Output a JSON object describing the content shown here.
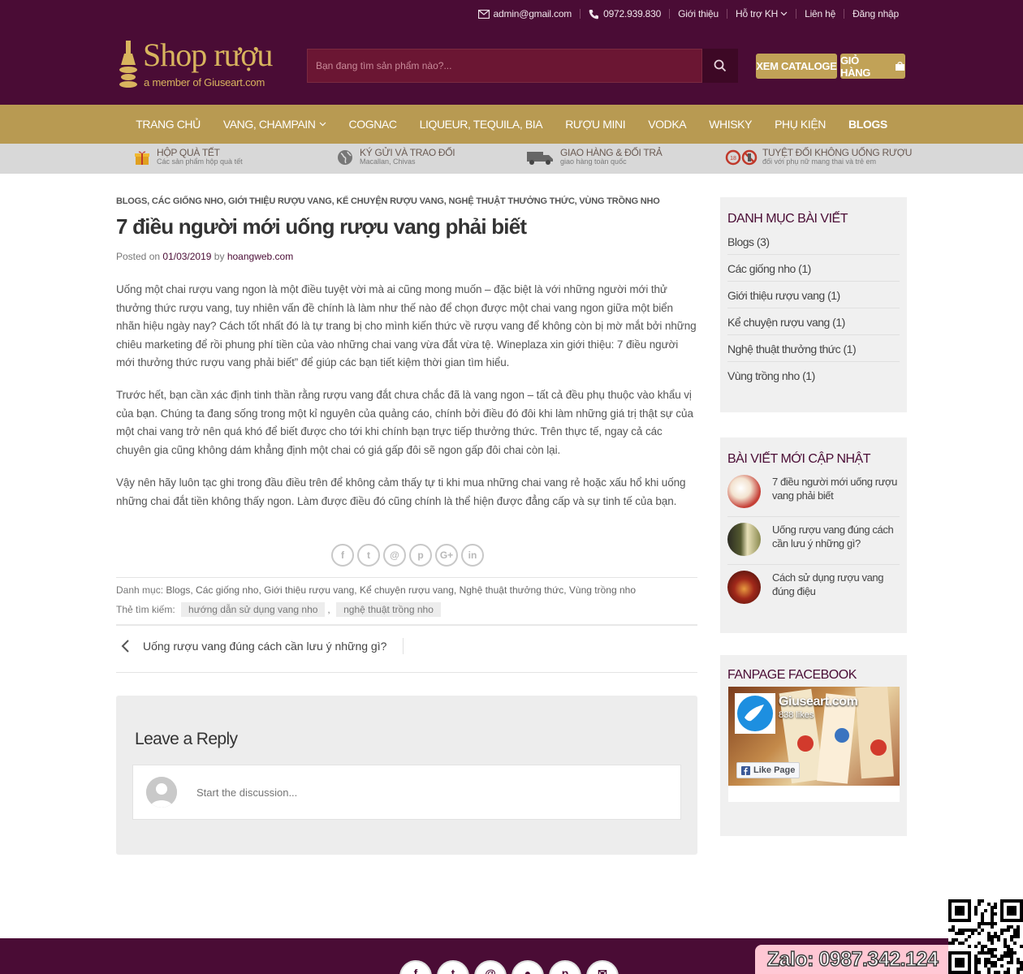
{
  "topbar": {
    "email": "admin@gmail.com",
    "phone": "0972.939.830",
    "links": [
      "Giới thiệu",
      "Hỗ trợ KH",
      "Liên hệ",
      "Đăng nhập"
    ]
  },
  "logo": {
    "brand": "Shop rượu",
    "tagline": "a member of Giuseart.com"
  },
  "search": {
    "placeholder": "Bạn đang tìm sản phẩm nào?..."
  },
  "header_buttons": {
    "catalogue": "XEM CATALOGE",
    "cart": "GIỎ HÀNG"
  },
  "nav": [
    "TRANG CHỦ",
    "VANG, CHAMPAIN",
    "COGNAC",
    "LIQUEUR, TEQUILA, BIA",
    "RƯỢU MINI",
    "VODKA",
    "WHISKY",
    "PHỤ KIỆN",
    "BLOGS"
  ],
  "features": [
    {
      "title": "HỘP QUÀ TẾT",
      "sub": "Các sản phẩm hộp quà tết",
      "icon": "gift-icon"
    },
    {
      "title": "KÝ GỬI VÀ TRAO ĐỔI",
      "sub": "Macallan, Chivas",
      "icon": "globe-icon"
    },
    {
      "title": "GIAO HÀNG & ĐỔI TRẢ",
      "sub": "giao hàng toàn quốc",
      "icon": "truck-icon"
    },
    {
      "title": "TUYỆT ĐỐI KHÔNG UỐNG RƯỢU",
      "sub": "đối với phụ nữ mang thai và trẻ em",
      "icon": "no-alcohol-icon"
    }
  ],
  "article": {
    "categories": "BLOGS, CÁC GIỐNG NHO, GIỚI THIỆU RƯỢU VANG, KỂ CHUYỆN RƯỢU VANG, NGHỆ THUẬT THƯỞNG THỨC, VÙNG TRỒNG NHO",
    "title": "7 điều người mới uống rượu vang phải biết",
    "posted_on": "Posted on",
    "date": "01/03/2019",
    "by": "by",
    "author": "hoangweb.com",
    "paragraphs": [
      "Uống một chai rượu vang ngon là một điều tuyệt vời mà ai cũng mong muốn – đặc biệt là với những người mới thử thưởng thức rượu vang, tuy nhiên vấn đề chính là làm như thế nào để chọn được một chai vang ngon giữa một biển nhãn hiệu ngày nay? Cách tốt nhất đó là tự trang bị cho mình kiến thức về rượu vang để không còn bị mờ mắt bởi những chiêu marketing để rồi phung phí tiền của vào những chai vang vừa đắt vừa tệ. Wineplaza xin giới thiệu: 7 điều người mới thưởng thức rượu vang phải biết” để giúp các bạn tiết kiệm thời gian tìm hiểu.",
      "Trước hết, bạn cần xác định tinh thần rằng rượu vang đắt chưa chắc đã là vang ngon – tất cả đều phụ thuộc vào khẩu vị của bạn. Chúng ta đang sống trong một kỉ nguyên của quảng cáo, chính bởi điều đó đôi khi làm những giá trị thật sự của một chai vang trở nên quá khó để biết được cho tới khi chính bạn trực tiếp thưởng thức. Trên thực tế, ngay cả các chuyên gia cũng không dám khẳng định một chai có giá gấp đôi sẽ ngon gấp đôi chai còn lại.",
      "Vậy nên hãy luôn tạc ghi trong đầu điều trên để không cảm thấy tự ti khi mua những chai vang rẻ hoặc xấu hổ khi uống những chai đắt tiền không thấy ngon. Làm được điều đó cũng chính là thể hiện được đẳng cấp và sự tinh tế của bạn."
    ],
    "share_icons": [
      "f",
      "t",
      "@",
      "p",
      "G+",
      "in"
    ],
    "category_label": "Danh mục:",
    "category_links": "Blogs, Các giống nho, Giới thiệu rượu vang, Kể chuyện rượu vang, Nghệ thuật thưởng thức, Vùng trồng nho",
    "tags_label": "Thẻ tìm kiếm:",
    "tags": [
      "hướng dẫn sử dụng vang nho",
      "nghệ thuật trồng nho"
    ],
    "tag_sep": ",",
    "prev_post": "Uống rượu vang đúng cách cần lưu ý những gì?"
  },
  "reply": {
    "heading": "Leave a Reply",
    "placeholder": "Start the discussion..."
  },
  "sidebar": {
    "categories_title": "DANH MỤC BÀI VIẾT",
    "categories": [
      "Blogs (3)",
      "Các giống nho (1)",
      "Giới thiệu rượu vang (1)",
      "Kể chuyện rượu vang (1)",
      "Nghệ thuật thưởng thức (1)",
      "Vùng trồng nho (1)"
    ],
    "recent_title": "BÀI VIẾT MỚI CẬP NHẬT",
    "recent": [
      "7 điều người mới uống rượu vang phải biết",
      "Uống rượu vang đúng cách cần lưu ý những gì?",
      "Cách sử dụng rượu vang đúng điệu"
    ],
    "fb_title": "FANPAGE FACEBOOK",
    "fb_name": "Giuseart.com",
    "fb_likes": "838 likes",
    "fb_like_btn": "Like Page"
  },
  "zalo": "Zalo: 0987.342.124",
  "colors": {
    "primary": "#4a0c35",
    "gold": "#b89a52",
    "feature_bar": "#d8d8d8"
  }
}
